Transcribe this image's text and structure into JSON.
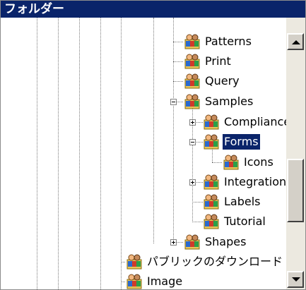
{
  "titlebar": {
    "title": "フォルダー"
  },
  "tree": {
    "items": [
      {
        "label": "Patterns",
        "icon": "shared-folder-icon"
      },
      {
        "label": "Print",
        "icon": "shared-folder-icon"
      },
      {
        "label": "Query",
        "icon": "shared-folder-icon"
      },
      {
        "label": "Samples",
        "icon": "shared-folder-icon",
        "expanded": true
      },
      {
        "label": "Compliance",
        "icon": "shared-folder-icon",
        "expanded": false
      },
      {
        "label": "Forms",
        "icon": "shared-folder-icon",
        "expanded": true,
        "selected": true
      },
      {
        "label": "Icons",
        "icon": "shared-folder-icon"
      },
      {
        "label": "Integration",
        "icon": "shared-folder-icon",
        "expanded": false
      },
      {
        "label": "Labels",
        "icon": "shared-folder-icon"
      },
      {
        "label": "Tutorial",
        "icon": "shared-folder-icon"
      },
      {
        "label": "Shapes",
        "icon": "shared-folder-icon",
        "expanded": false
      },
      {
        "label": "パブリックのダウンロード",
        "icon": "shared-folder-icon"
      },
      {
        "label": "Image",
        "icon": "shared-folder-icon"
      }
    ]
  },
  "colors": {
    "selection": "#0a246a",
    "titlebar": "#0a246a"
  }
}
